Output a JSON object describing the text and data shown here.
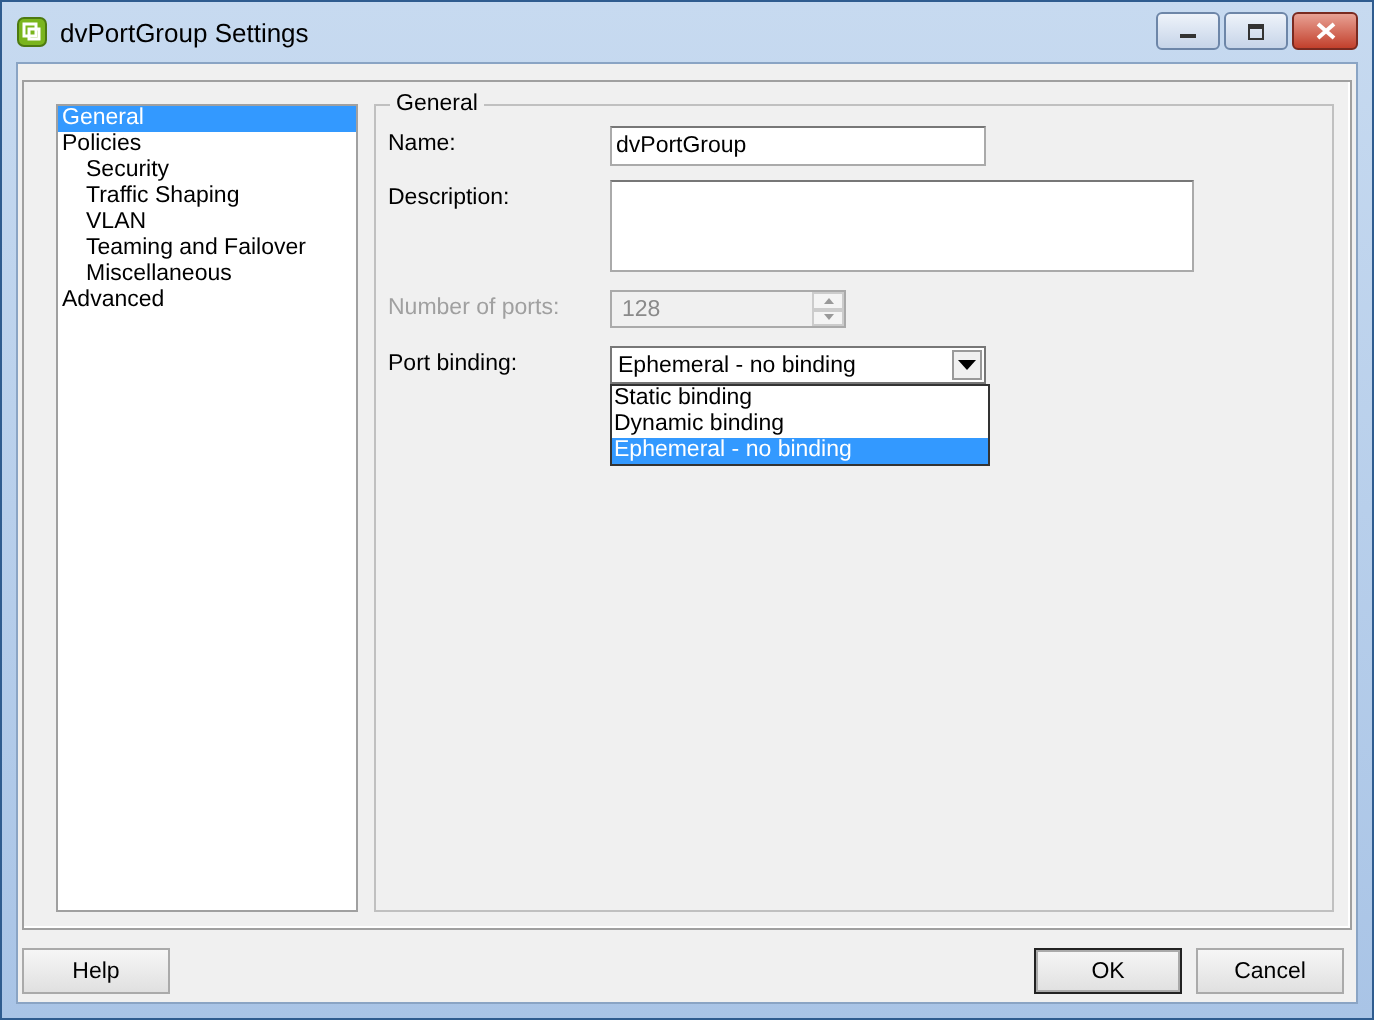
{
  "window": {
    "title": "dvPortGroup Settings"
  },
  "sidebar": {
    "items": [
      {
        "label": "General",
        "selected": true
      },
      {
        "label": "Policies",
        "selected": false,
        "children": [
          {
            "label": "Security",
            "selected": false
          },
          {
            "label": "Traffic Shaping",
            "selected": false
          },
          {
            "label": "VLAN",
            "selected": false
          },
          {
            "label": "Teaming and Failover",
            "selected": false
          },
          {
            "label": "Miscellaneous",
            "selected": false
          }
        ]
      },
      {
        "label": "Advanced",
        "selected": false
      }
    ]
  },
  "general": {
    "title": "General",
    "fields": [
      {
        "kind": "text",
        "label": "Name:",
        "value": "dvPortGroup",
        "disabled": false
      },
      {
        "kind": "textarea",
        "label": "Description:",
        "disabled": false
      },
      {
        "kind": "spinner",
        "label": "Number of ports:",
        "value": "128",
        "disabled": true
      },
      {
        "kind": "combo",
        "label": "Port binding:",
        "value": "Ephemeral - no binding",
        "disabled": false,
        "expanded": true,
        "options": [
          {
            "label": "Static binding",
            "selected": false
          },
          {
            "label": "Dynamic binding",
            "selected": false
          },
          {
            "label": "Ephemeral - no binding",
            "selected": true
          }
        ]
      }
    ]
  },
  "buttons": {
    "left": [
      {
        "label": "Help",
        "default": false
      }
    ],
    "right": [
      {
        "label": "OK",
        "default": true
      },
      {
        "label": "Cancel",
        "default": false
      }
    ]
  }
}
